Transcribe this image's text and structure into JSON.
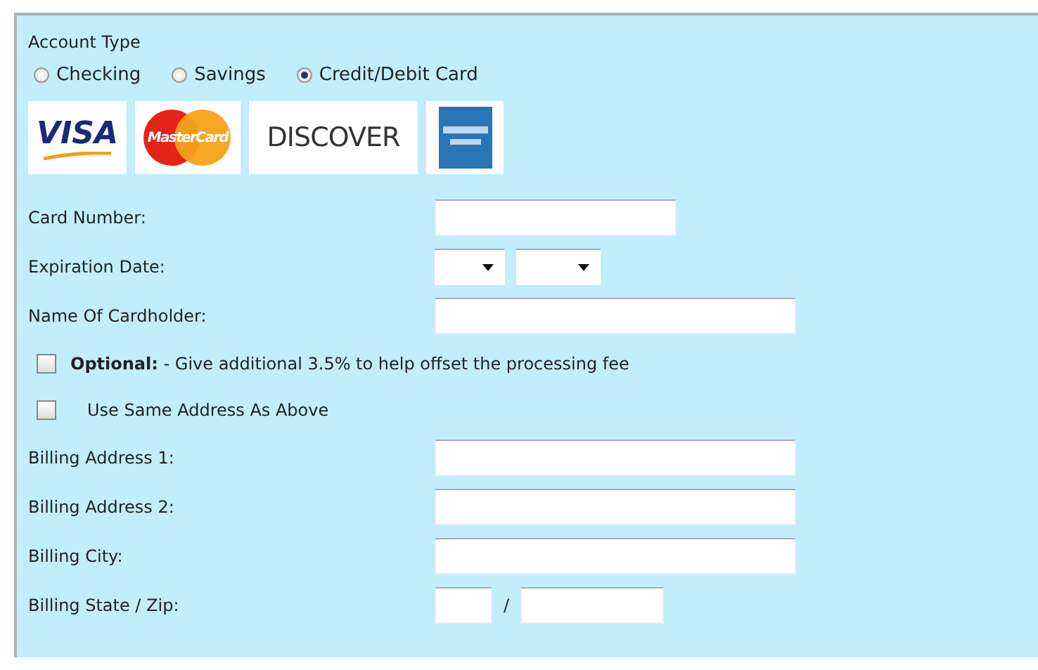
{
  "account_type": {
    "label": "Account Type",
    "options": [
      {
        "label": "Checking",
        "selected": false
      },
      {
        "label": "Savings",
        "selected": false
      },
      {
        "label": "Credit/Debit Card",
        "selected": true
      }
    ]
  },
  "cards": [
    {
      "kind": "visa",
      "text": "VISA"
    },
    {
      "kind": "mastercard",
      "text": "MasterCard"
    },
    {
      "kind": "discover",
      "text": "DISCOVER"
    },
    {
      "kind": "amex"
    }
  ],
  "rows": [
    {
      "kind": "short_field",
      "label": "Card Number:"
    },
    {
      "kind": "expiry",
      "label": "Expiration Date:"
    },
    {
      "kind": "long_field",
      "label": "Name Of Cardholder:"
    },
    {
      "kind": "checkbox",
      "label": "**Optional:** - Give additional 3.5% to help offset the processing fee",
      "checked": false
    },
    {
      "kind": "indented_checkbox",
      "label": "Use Same Address As Above",
      "checked": false
    },
    {
      "kind": "long_field",
      "label": "Billing Address 1:"
    },
    {
      "kind": "long_field",
      "label": "Billing Address 2:"
    },
    {
      "kind": "long_field",
      "label": "Billing City:"
    },
    {
      "kind": "state_zip",
      "label": "Billing State / Zip:",
      "separator": "/"
    }
  ]
}
